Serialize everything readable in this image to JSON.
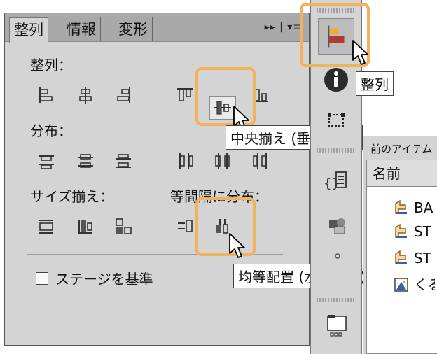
{
  "panel": {
    "tabs": [
      {
        "label": "整列",
        "active": true
      },
      {
        "label": "情報",
        "active": false
      },
      {
        "label": "変形",
        "active": false
      }
    ],
    "menu_glyph": "▸▸ | ▾≡",
    "sections": {
      "align_label": "整列：",
      "distribute_label": "分布：",
      "match_size_label": "サイズ揃え：",
      "space_label": "等間隔に分布：",
      "to_stage_label": "ステージを基準"
    },
    "to_stage_checked": false
  },
  "tooltips": {
    "center_vertical": "中央揃え (垂直方向)",
    "space_horizontal": "均等配置 (水平方向)",
    "align_button": "整列"
  },
  "library": {
    "title": "前のアイテム",
    "column_name": "名前",
    "rows": [
      {
        "label": "BA",
        "icon": "movieclip-icon"
      },
      {
        "label": "ST",
        "icon": "movieclip-icon"
      },
      {
        "label": "ST",
        "icon": "movieclip-icon"
      },
      {
        "label": "くる",
        "icon": "graphic-icon"
      }
    ]
  },
  "colors": {
    "highlight": "#f3b15c",
    "panel_bg": "#d4d4d4",
    "tab_bar": "#a9a9a9",
    "align_icon_accent": "#c0392b"
  }
}
